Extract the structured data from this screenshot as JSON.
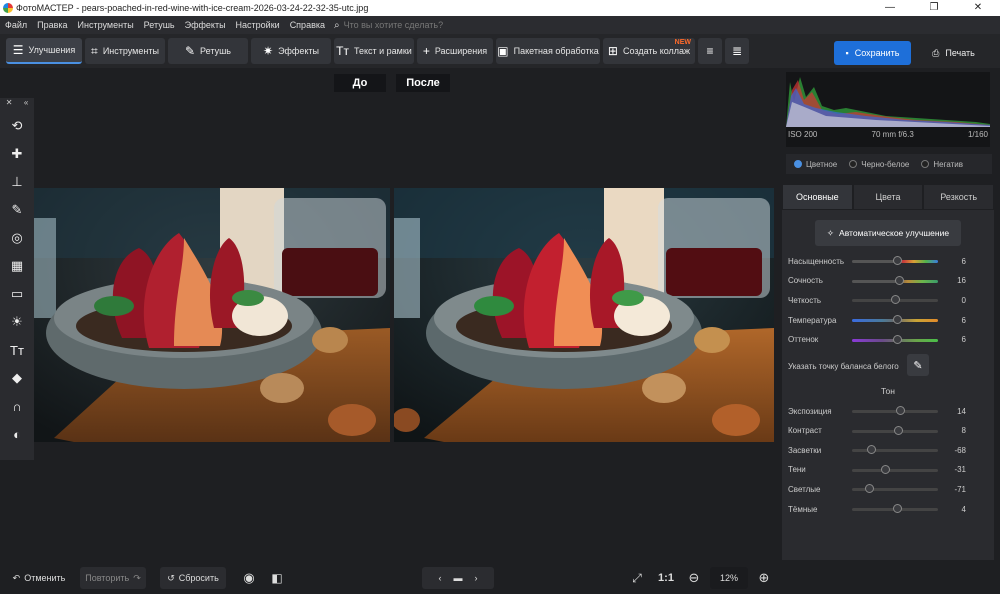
{
  "titlebar": {
    "app": "ФотоМАСТЕР",
    "file": "pears-poached-in-red-wine-with-ice-cream-2026-03-24-22-32-35-utc.jpg",
    "minimize": "—",
    "maximize": "❐",
    "close": "✕"
  },
  "menu": [
    "Файл",
    "Правка",
    "Инструменты",
    "Ретушь",
    "Эффекты",
    "Настройки",
    "Справка"
  ],
  "search": {
    "placeholder": "Что вы хотите сделать?"
  },
  "toolbar": {
    "enhance": "Улучшения",
    "tools": "Инструменты",
    "retouch": "Ретушь",
    "effects": "Эффекты",
    "text": "Текст и рамки",
    "extensions": "Расширения",
    "batch": "Пакетная обработка",
    "collage": "Создать коллаж",
    "new_badge": "NEW",
    "save": "Сохранить",
    "print": "Печать"
  },
  "canvas": {
    "before": "До",
    "after": "После"
  },
  "histogram": {
    "iso": "ISO 200",
    "lens": "70 mm f/6.3",
    "shutter": "1/160"
  },
  "color_modes": {
    "color": "Цветное",
    "bw": "Черно-белое",
    "negative": "Негатив",
    "selected": "color"
  },
  "tabs": {
    "basic": "Основные",
    "colors": "Цвета",
    "sharpness": "Резкость"
  },
  "auto_button": "Автоматическое улучшение",
  "color_sliders": [
    {
      "name": "Насыщенность",
      "value": "6",
      "pos": 0.52
    },
    {
      "name": "Сочность",
      "value": "16",
      "pos": 0.55
    },
    {
      "name": "Четкость",
      "value": "0",
      "pos": 0.5
    },
    {
      "name": "Температура",
      "value": "6",
      "pos": 0.52
    },
    {
      "name": "Оттенок",
      "value": "6",
      "pos": 0.52
    }
  ],
  "white_balance": "Указать точку баланса белого",
  "tone_header": "Тон",
  "tone_sliders": [
    {
      "name": "Экспозиция",
      "value": "14",
      "pos": 0.56
    },
    {
      "name": "Контраст",
      "value": "8",
      "pos": 0.53
    },
    {
      "name": "Засветки",
      "value": "-68",
      "pos": 0.22
    },
    {
      "name": "Тени",
      "value": "-31",
      "pos": 0.38
    },
    {
      "name": "Светлые",
      "value": "-71",
      "pos": 0.2
    },
    {
      "name": "Тёмные",
      "value": "4",
      "pos": 0.52
    }
  ],
  "bottom": {
    "undo": "Отменить",
    "redo": "Повторить",
    "reset": "Сбросить",
    "ratio": "1:1",
    "zoom": "12%"
  }
}
